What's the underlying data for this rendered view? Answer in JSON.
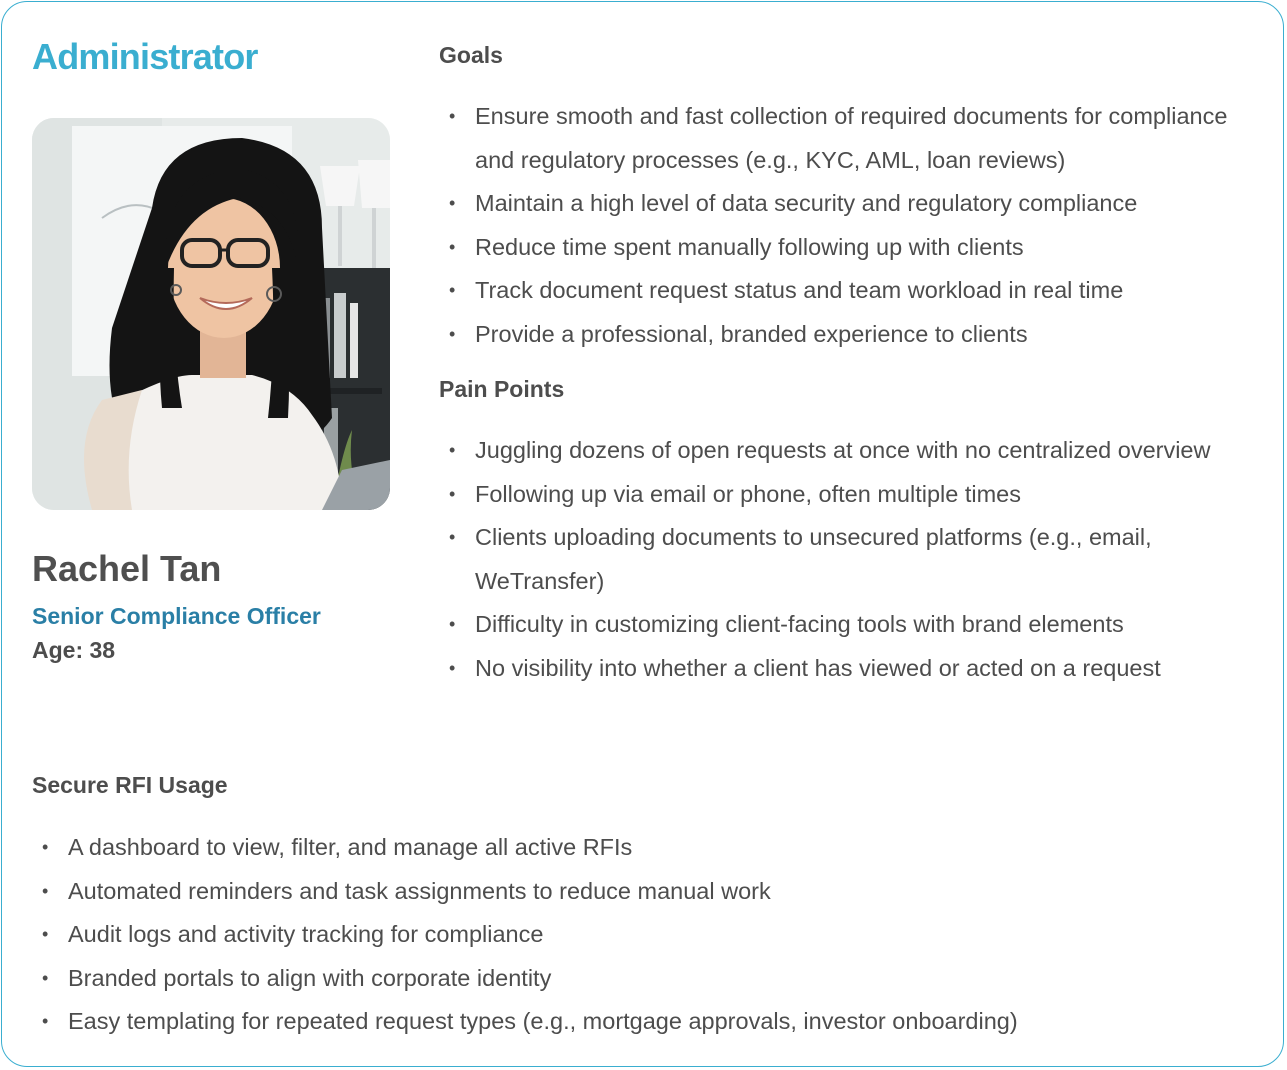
{
  "persona": {
    "role_title": "Administrator",
    "name": "Rachel Tan",
    "job_title": "Senior Compliance Officer",
    "age": "Age: 38"
  },
  "goals": {
    "heading": "Goals",
    "items": [
      "Ensure smooth and fast collection of required documents for compliance and regulatory processes (e.g., KYC, AML, loan reviews)",
      "Maintain a high level of data security and regulatory compliance",
      "Reduce time spent manually following up with clients",
      "Track document request status and team workload in real time",
      "Provide a professional, branded experience to clients"
    ]
  },
  "pain_points": {
    "heading": "Pain Points",
    "items": [
      "Juggling dozens of open requests at once with no centralized overview",
      "Following up via email or phone, often multiple times",
      "Clients uploading documents to unsecured platforms (e.g., email, WeTransfer)",
      "Difficulty in customizing client-facing tools with brand elements",
      "No visibility into whether a client has viewed or acted on a request"
    ]
  },
  "secure_rfi_usage": {
    "heading": "Secure RFI Usage",
    "items": [
      "A dashboard to view, filter, and manage all active RFIs",
      "Automated reminders and task assignments to reduce manual work",
      "Audit logs and activity tracking for compliance",
      "Branded portals to align with corporate identity",
      "Easy templating for repeated request types (e.g., mortgage approvals, investor onboarding)"
    ]
  },
  "colors": {
    "accent": "#3aaed0",
    "job_title": "#2a7fa6",
    "text": "#4d4d4d"
  }
}
